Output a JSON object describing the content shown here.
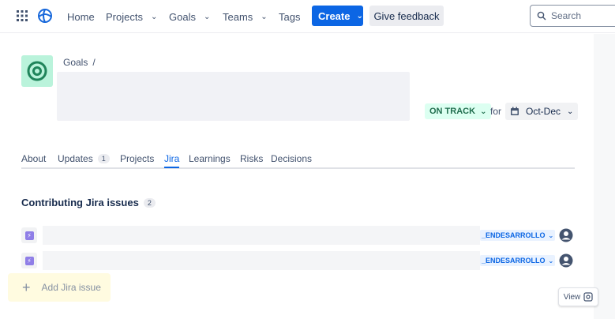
{
  "nav": {
    "home": "Home",
    "projects": "Projects",
    "goals": "Goals",
    "teams": "Teams",
    "tags": "Tags",
    "create": "Create",
    "feedback": "Give feedback",
    "search_placeholder": "Search"
  },
  "breadcrumb": {
    "parent": "Goals",
    "separator": "/"
  },
  "goal": {
    "status": "ON TRACK",
    "for_label": "for",
    "period": "Oct-Dec",
    "colors": {
      "status_bg": "#dcfff1",
      "status_text": "#216e4e",
      "icon_bg": "#baf3db"
    }
  },
  "tabs": [
    {
      "label": "About"
    },
    {
      "label": "Updates",
      "count": "1"
    },
    {
      "label": "Projects"
    },
    {
      "label": "Jira",
      "active": true
    },
    {
      "label": "Learnings"
    },
    {
      "label": "Risks"
    },
    {
      "label": "Decisions"
    }
  ],
  "section": {
    "title": "Contributing Jira issues",
    "count": "2"
  },
  "issues": [
    {
      "status": "_ENDESARROLLO",
      "icon": "story-icon",
      "assignee_icon": "user-avatar-icon"
    },
    {
      "status": "_ENDESARROLLO",
      "icon": "story-icon",
      "assignee_icon": "user-avatar-icon"
    }
  ],
  "add_issue": "Add Jira issue",
  "view_button": "View",
  "accent_color": "#0c66e4"
}
